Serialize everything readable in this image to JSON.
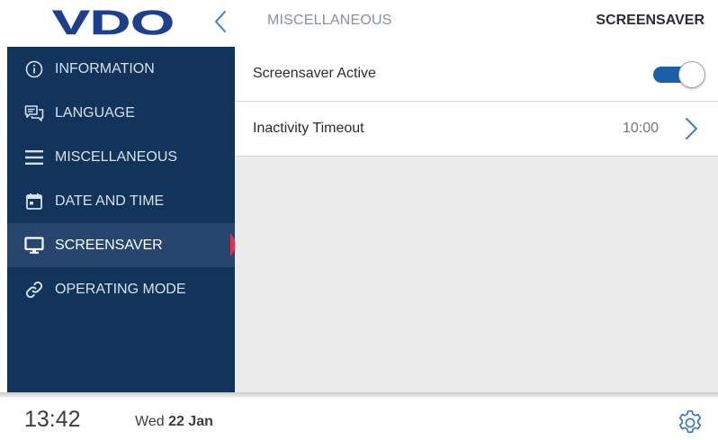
{
  "header": {
    "logo_text": "VDO",
    "breadcrumb": "MISCELLANEOUS",
    "title": "SCREENSAVER",
    "back_icon": "chevron-left-icon"
  },
  "sidebar": {
    "items": [
      {
        "label": "INFORMATION",
        "icon": "info-circle-icon",
        "active": false
      },
      {
        "label": "LANGUAGE",
        "icon": "speech-bubbles-icon",
        "active": false
      },
      {
        "label": "MISCELLANEOUS",
        "icon": "hamburger-menu-icon",
        "active": false
      },
      {
        "label": "DATE AND TIME",
        "icon": "calendar-icon",
        "active": false
      },
      {
        "label": "SCREENSAVER",
        "icon": "monitor-icon",
        "active": true
      },
      {
        "label": "OPERATING MODE",
        "icon": "link-icon",
        "active": false
      }
    ]
  },
  "settings": {
    "screensaver_active": {
      "label": "Screensaver Active",
      "enabled": true
    },
    "inactivity_timeout": {
      "label": "Inactivity Timeout",
      "value": "10:00"
    }
  },
  "footer": {
    "time": "13:42",
    "weekday": "Wed",
    "date": "22 Jan",
    "settings_icon": "gear-icon"
  },
  "colors": {
    "sidebar_bg": "#12335a",
    "sidebar_active_bg": "#27466d",
    "accent": "#1c5fa6",
    "active_marker": "#e0334a",
    "logo": "#1e3f8a",
    "content_bg": "#ebebeb"
  }
}
